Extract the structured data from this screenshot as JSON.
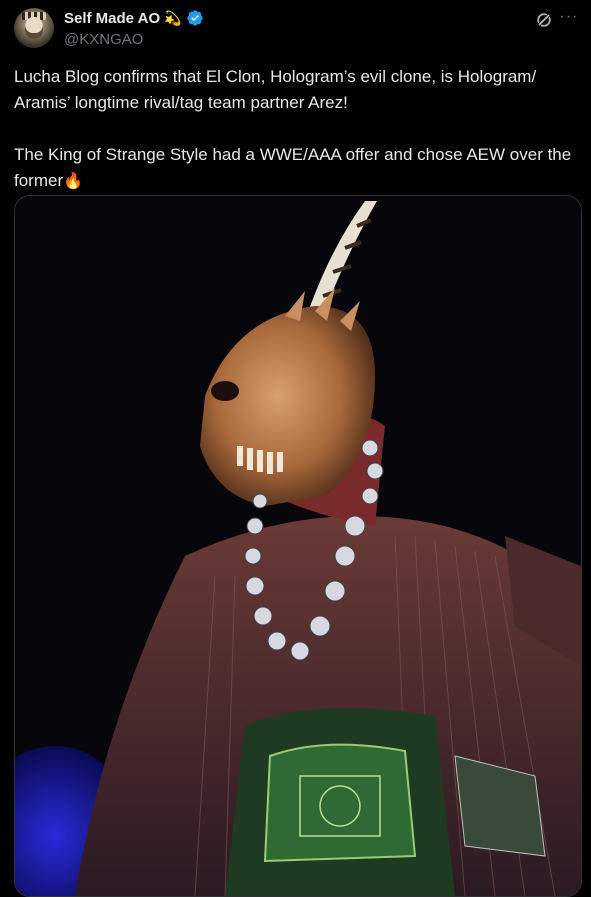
{
  "user": {
    "display_name": "Self Made AO",
    "name_emoji": "💫",
    "handle": "@KXNGAO",
    "verified": true
  },
  "tweet": {
    "text": "Lucha Blog confirms that El Clon, Hologram’s evil clone, is Hologram/\nAramis’ longtime rival/tag team partner Arez!\n\nThe King of Strange Style had a WWE/AAA offer and chose AEW over the\nformer",
    "emoji": "🔥"
  },
  "media": {
    "alt": "Masked luchador with horned skull mask, bead necklace and championship belt on dark background"
  },
  "icons": {
    "grok": "grok-icon",
    "more": "more-options-icon",
    "verified": "verified-badge-icon"
  },
  "colors": {
    "background": "#000000",
    "text": "#e7e9ea",
    "secondary": "#71767b",
    "verified": "#1d9bf0"
  }
}
